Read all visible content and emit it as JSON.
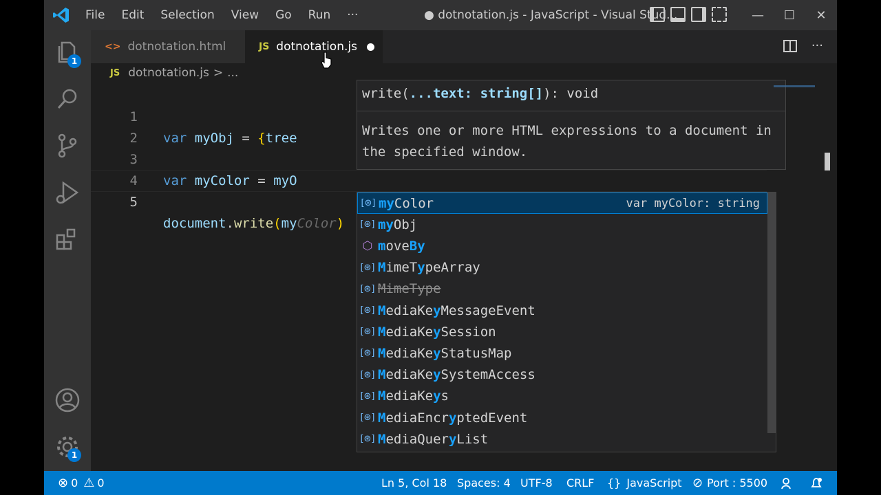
{
  "titlebar": {
    "menu": [
      "File",
      "Edit",
      "Selection",
      "View",
      "Go",
      "Run",
      "···"
    ],
    "title": "● dotnotation.js - JavaScript - Visual Stud...",
    "minimize": "—",
    "maximize": "☐",
    "close": "✕"
  },
  "activity": {
    "explorer_badge": "1",
    "settings_badge": "1"
  },
  "tabs": [
    {
      "icon": "<>",
      "label": "dotnotation.html",
      "active": false
    },
    {
      "icon": "JS",
      "label": "dotnotation.js",
      "active": true,
      "dirty": true
    }
  ],
  "tab_actions": {
    "more": "···"
  },
  "breadcrumb": {
    "icon": "JS",
    "file": "dotnotation.js",
    "sep": ">",
    "rest": "..."
  },
  "editor": {
    "lines": [
      {
        "n": "1",
        "code": "var myObj = {tree"
      },
      {
        "n": "2",
        "code": ""
      },
      {
        "n": "3",
        "code": "var myColor = myO"
      },
      {
        "n": "4",
        "code": ""
      },
      {
        "n": "5",
        "code": "document.write(myColor)"
      }
    ],
    "ghost_text": "Color",
    "line1": {
      "kw": "var",
      "name": "myObj",
      "rest": " = ",
      "brace": "{",
      "tail": "tree"
    },
    "line3": {
      "kw": "var",
      "name": "myColor",
      "rest": " = ",
      "tail": "myO"
    },
    "line5": {
      "obj": "document",
      "dot": ".",
      "fn": "write",
      "open": "(",
      "typed": "my",
      "close": ")"
    }
  },
  "hover": {
    "sig_fn": "write(",
    "sig_param": "...text:",
    "sig_type": " string[]",
    "sig_end": "): void",
    "doc": "Writes one or more HTML expressions to a document in the specified window."
  },
  "suggestions": [
    {
      "icon": "variable",
      "parts": [
        [
          "my",
          true
        ],
        [
          "Color",
          false
        ]
      ],
      "detail": "var myColor: string",
      "selected": true
    },
    {
      "icon": "variable",
      "parts": [
        [
          "my",
          true
        ],
        [
          "Obj",
          false
        ]
      ]
    },
    {
      "icon": "method",
      "parts": [
        [
          "m",
          true
        ],
        [
          "ove",
          false
        ],
        [
          "By",
          true
        ]
      ]
    },
    {
      "icon": "variable",
      "parts": [
        [
          "M",
          true
        ],
        [
          "imeT",
          false
        ],
        [
          "y",
          true
        ],
        [
          "peArray",
          false
        ]
      ]
    },
    {
      "icon": "variable",
      "parts": [
        [
          "MimeType",
          false
        ]
      ],
      "deprecated": true
    },
    {
      "icon": "variable",
      "parts": [
        [
          "M",
          true
        ],
        [
          "ediaKe",
          false
        ],
        [
          "y",
          true
        ],
        [
          "MessageEvent",
          false
        ]
      ]
    },
    {
      "icon": "variable",
      "parts": [
        [
          "M",
          true
        ],
        [
          "ediaKe",
          false
        ],
        [
          "y",
          true
        ],
        [
          "Session",
          false
        ]
      ]
    },
    {
      "icon": "variable",
      "parts": [
        [
          "M",
          true
        ],
        [
          "ediaKe",
          false
        ],
        [
          "y",
          true
        ],
        [
          "StatusMap",
          false
        ]
      ]
    },
    {
      "icon": "variable",
      "parts": [
        [
          "M",
          true
        ],
        [
          "ediaKe",
          false
        ],
        [
          "y",
          true
        ],
        [
          "SystemAccess",
          false
        ]
      ]
    },
    {
      "icon": "variable",
      "parts": [
        [
          "M",
          true
        ],
        [
          "ediaKe",
          false
        ],
        [
          "y",
          true
        ],
        [
          "s",
          false
        ]
      ]
    },
    {
      "icon": "variable",
      "parts": [
        [
          "M",
          true
        ],
        [
          "ediaEncr",
          false
        ],
        [
          "y",
          true
        ],
        [
          "ptedEvent",
          false
        ]
      ]
    },
    {
      "icon": "variable",
      "parts": [
        [
          "M",
          true
        ],
        [
          "ediaQuer",
          false
        ],
        [
          "y",
          true
        ],
        [
          "List",
          false
        ]
      ]
    }
  ],
  "status": {
    "errors": "0",
    "warnings": "0",
    "position": "Ln 5, Col 18",
    "spaces": "Spaces: 4",
    "encoding": "UTF-8",
    "eol": "CRLF",
    "language": "JavaScript",
    "port": "Port : 5500"
  },
  "colors": {
    "accent": "#007acc",
    "editor_bg": "#1e1e1e",
    "keyword": "#569cd6",
    "variable": "#9cdcfe"
  }
}
